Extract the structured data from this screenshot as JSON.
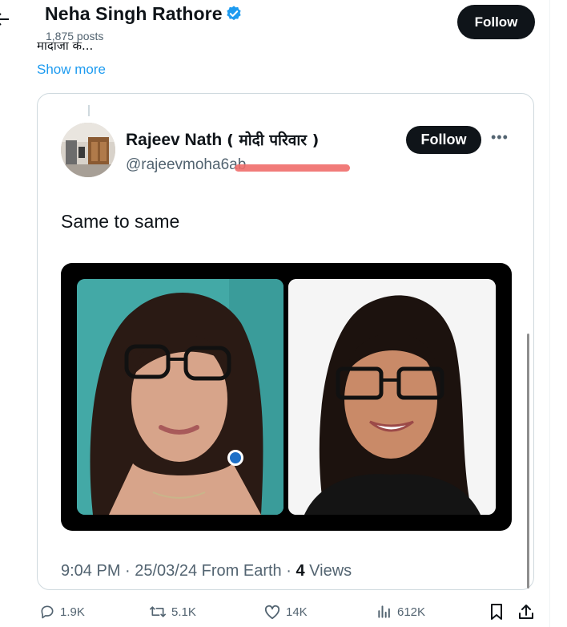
{
  "header": {
    "name": "Neha Singh Rathore",
    "posts": "1,875 posts",
    "follow_label": "Follow"
  },
  "post": {
    "clipped_text": "मोदीजी के...",
    "show_more": "Show more"
  },
  "quoted": {
    "name": "Rajeev Nath",
    "name_suffix": "( मोदी परिवार )",
    "handle": "@rajeevmoha6ab",
    "follow_label": "Follow",
    "more": "•••",
    "text": "Same to same",
    "time": "9:04 PM · 25/03/24 From Earth · ",
    "views_count": "4",
    "views_label": " Views"
  },
  "actions": {
    "replies": "1.9K",
    "reposts": "5.1K",
    "likes": "14K",
    "views": "612K"
  },
  "colors": {
    "accent": "#1d9bf0",
    "button_bg": "#0f1419",
    "secondary_text": "#536471",
    "redaction": "#f06d6a"
  },
  "icons": [
    "back-arrow-icon",
    "verified-badge-icon",
    "more-icon",
    "reply-icon",
    "repost-icon",
    "like-icon",
    "views-icon",
    "bookmark-icon",
    "share-icon"
  ]
}
